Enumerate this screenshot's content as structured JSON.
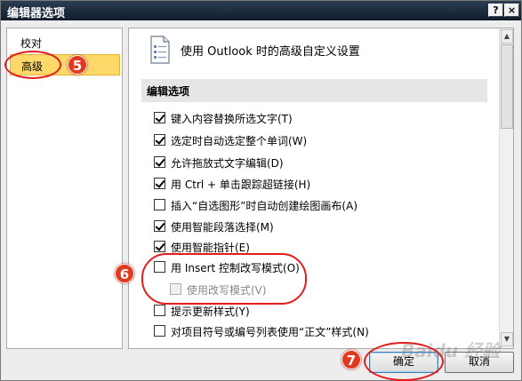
{
  "window": {
    "title": "编辑器选项",
    "help": "?",
    "close": "×"
  },
  "sidebar": {
    "items": [
      {
        "label": "校对"
      },
      {
        "label": "高级"
      }
    ]
  },
  "panel": {
    "title": "使用 Outlook 时的高级自定义设置",
    "section": "编辑选项"
  },
  "options": [
    {
      "label": "键入内容替换所选文字(T)",
      "checked": true
    },
    {
      "label": "选定时自动选定整个单词(W)",
      "checked": true
    },
    {
      "label": "允许拖放式文字编辑(D)",
      "checked": true
    },
    {
      "label": "用 Ctrl + 单击跟踪超链接(H)",
      "checked": true
    },
    {
      "label": "插入“自选图形”时自动创建绘图画布(A)",
      "checked": false
    },
    {
      "label": "使用智能段落选择(M)",
      "checked": true
    },
    {
      "label": "使用智能指针(E)",
      "checked": true
    },
    {
      "label": "用 Insert 控制改写模式(O)",
      "checked": false
    },
    {
      "label": "使用改写模式(V)",
      "checked": false,
      "disabled": true
    },
    {
      "label": "提示更新样式(Y)",
      "checked": false
    },
    {
      "label": "对项目符号或编号列表使用“正文”样式(N)",
      "checked": false
    }
  ],
  "buttons": {
    "ok": "确定",
    "cancel": "取消"
  },
  "annotations": {
    "badge5": "5",
    "badge6": "6",
    "badge7": "7"
  },
  "colors": {
    "selected_bg": "#ffd86a",
    "annotation_red": "#e31c1c"
  },
  "watermark": "Baidu 经验"
}
